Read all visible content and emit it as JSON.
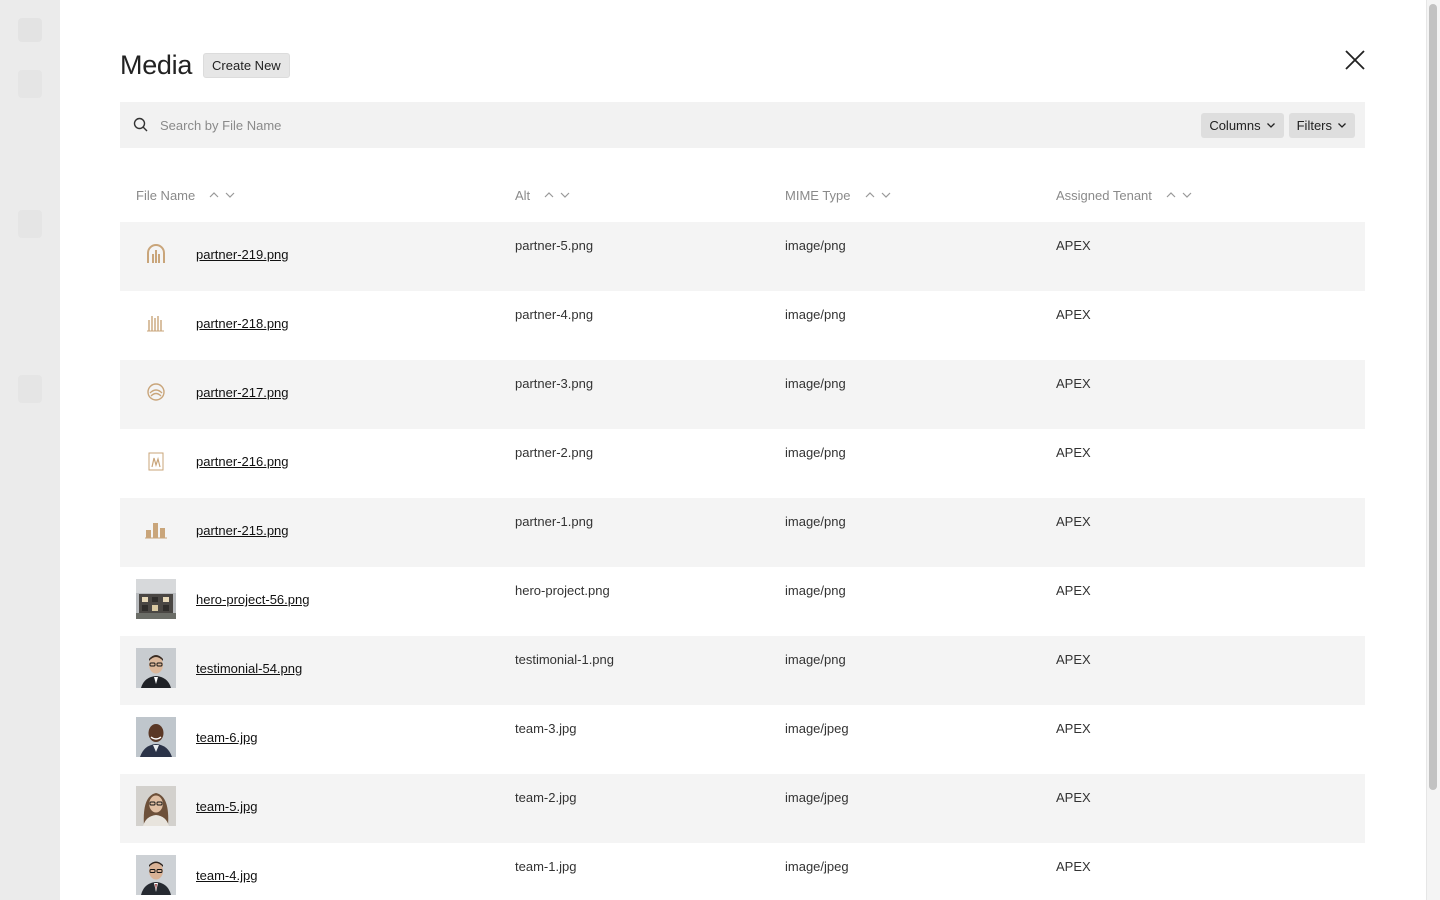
{
  "header": {
    "title": "Media",
    "create_label": "Create New"
  },
  "search": {
    "placeholder": "Search by File Name",
    "columns_label": "Columns",
    "filters_label": "Filters"
  },
  "table": {
    "columns": [
      "File Name",
      "Alt",
      "MIME Type",
      "Assigned Tenant"
    ],
    "rows": [
      {
        "file": "partner-219.png",
        "alt": "partner-5.png",
        "mime": "image/png",
        "tenant": "APEX",
        "thumb": "partner-logo-arch"
      },
      {
        "file": "partner-218.png",
        "alt": "partner-4.png",
        "mime": "image/png",
        "tenant": "APEX",
        "thumb": "partner-logo-bars"
      },
      {
        "file": "partner-217.png",
        "alt": "partner-3.png",
        "mime": "image/png",
        "tenant": "APEX",
        "thumb": "partner-logo-circle"
      },
      {
        "file": "partner-216.png",
        "alt": "partner-2.png",
        "mime": "image/png",
        "tenant": "APEX",
        "thumb": "partner-logo-frame"
      },
      {
        "file": "partner-215.png",
        "alt": "partner-1.png",
        "mime": "image/png",
        "tenant": "APEX",
        "thumb": "partner-logo-buildings"
      },
      {
        "file": "hero-project-56.png",
        "alt": "hero-project.png",
        "mime": "image/png",
        "tenant": "APEX",
        "thumb": "building-photo"
      },
      {
        "file": "testimonial-54.png",
        "alt": "testimonial-1.png",
        "mime": "image/png",
        "tenant": "APEX",
        "thumb": "portrait-man-glasses"
      },
      {
        "file": "team-6.jpg",
        "alt": "team-3.jpg",
        "mime": "image/jpeg",
        "tenant": "APEX",
        "thumb": "portrait-man-smiling"
      },
      {
        "file": "team-5.jpg",
        "alt": "team-2.jpg",
        "mime": "image/jpeg",
        "tenant": "APEX",
        "thumb": "portrait-woman-glasses"
      },
      {
        "file": "team-4.jpg",
        "alt": "team-1.jpg",
        "mime": "image/jpeg",
        "tenant": "APEX",
        "thumb": "portrait-man-suit"
      }
    ]
  },
  "colors": {
    "accent_gold": "#c9a57a",
    "row_shade": "#f4f4f4",
    "header_text": "#8a8a8a"
  }
}
